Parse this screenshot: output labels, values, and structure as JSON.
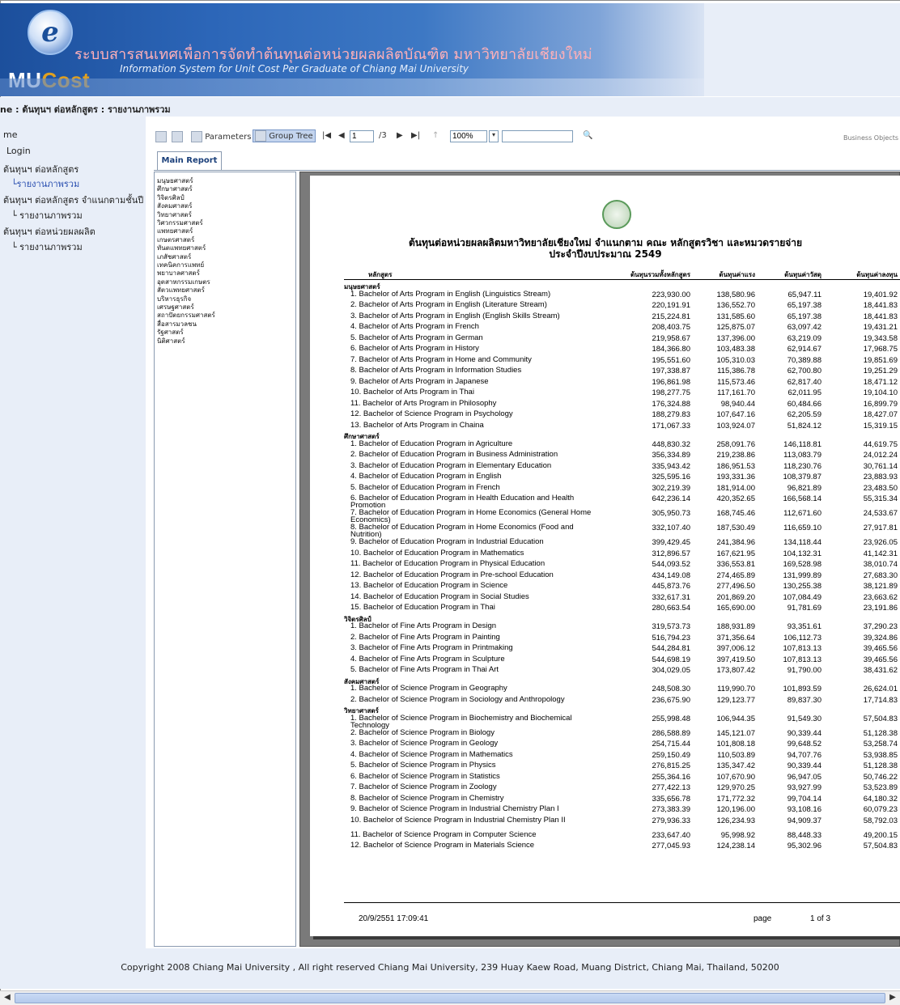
{
  "header": {
    "logo_letter": "e",
    "title_th": "ระบบสารสนเทศเพื่อการจัดทำต้นทุนต่อหน่วยผลผลิตบัณฑิต มหาวิทยาลัยเชียงใหม่",
    "title_en": "Information System for Unit Cost Per Graduate of Chiang Mai University",
    "brand_mu": "MU",
    "brand_cost": "Cost"
  },
  "breadcrumb": "ne : ต้นทุนฯ ต่อหลักสูตร : รายงานภาพรวม",
  "sidebar": {
    "items": [
      {
        "label": "me",
        "type": "link"
      },
      {
        "label": "Login",
        "type": "link"
      },
      {
        "label": "ต้นทุนฯ ต่อหลักสูตร",
        "type": "section"
      },
      {
        "label": "รายงานภาพรวม",
        "type": "current"
      },
      {
        "label": "ต้นทุนฯ ต่อหลักสูตร จำแนกตามชั้นปี",
        "type": "section"
      },
      {
        "label": "รายงานภาพรวม",
        "type": "sub"
      },
      {
        "label": "ต้นทุนฯ ต่อหน่วยผลผลิต",
        "type": "section"
      },
      {
        "label": "รายงานภาพรวม",
        "type": "sub"
      }
    ]
  },
  "toolbar": {
    "parameters_label": "Parameters",
    "group_tree_label": "Group Tree",
    "page_value": "1",
    "page_total": "/3",
    "zoom_value": "100%",
    "search_value": "",
    "brand": "Business Objects"
  },
  "tabs": {
    "main_report": "Main Report"
  },
  "group_tree": [
    "มนุษยศาสตร์",
    "ศึกษาศาสตร์",
    "วิจิตรศิลป์",
    "สังคมศาสตร์",
    "วิทยาศาสตร์",
    "วิศวกรรมศาสตร์",
    "แพทยศาสตร์",
    "เกษตรศาสตร์",
    "ทันตแพทยศาสตร์",
    "เภสัชศาสตร์",
    "เทคนิคการแพทย์",
    "พยาบาลศาสตร์",
    "อุตสาหกรรมเกษตร",
    "สัตวแพทยศาสตร์",
    "บริหารธุรกิจ",
    "เศรษฐศาสตร์",
    "สถาปัตยกรรมศาสตร์",
    "สื่อสารมวลชน",
    "รัฐศาสตร์",
    "นิติศาสตร์"
  ],
  "report": {
    "title_line1": "ต้นทุนต่อหน่วยผลผลิตมหาวิทยาลัยเชียงใหม่ จำแนกตาม คณะ หลักสูตรวิชา และหมวดรายจ่าย",
    "title_line2": "ประจำปีงบประมาณ 2549",
    "columns": [
      "หลักสูตร",
      "ต้นทุนรวมทั้งหลักสูตร",
      "ต้นทุนค่าแรง",
      "ต้นทุนค่าวัสดุ",
      "ต้นทุนค่าลงทุน"
    ],
    "groups": [
      {
        "name": "มนุษยศาสตร์",
        "rows": [
          [
            "1. Bachelor of Arts Program in English (Linguistics Stream)",
            "223,930.00",
            "138,580.96",
            "65,947.11",
            "19,401.92"
          ],
          [
            "2. Bachelor of Arts Program in English (Literature Stream)",
            "220,191.91",
            "136,552.70",
            "65,197.38",
            "18,441.83"
          ],
          [
            "3. Bachelor of Arts Program in English (English Skills Stream)",
            "215,224.81",
            "131,585.60",
            "65,197.38",
            "18,441.83"
          ],
          [
            "4. Bachelor of Arts Program in French",
            "208,403.75",
            "125,875.07",
            "63,097.42",
            "19,431.21"
          ],
          [
            "5. Bachelor of Arts Program in German",
            "219,958.67",
            "137,396.00",
            "63,219.09",
            "19,343.58"
          ],
          [
            "6. Bachelor of Arts Program in History",
            "184,366.80",
            "103,483.38",
            "62,914.67",
            "17,968.75"
          ],
          [
            "7. Bachelor of Arts Program in Home and Community",
            "195,551.60",
            "105,310.03",
            "70,389.88",
            "19,851.69"
          ],
          [
            "8. Bachelor of Arts Program in Information Studies",
            "197,338.87",
            "115,386.78",
            "62,700.80",
            "19,251.29"
          ],
          [
            "9. Bachelor of Arts Program in Japanese",
            "196,861.98",
            "115,573.46",
            "62,817.40",
            "18,471.12"
          ],
          [
            "10. Bachelor of Arts Program in Thai",
            "198,277.75",
            "117,161.70",
            "62,011.95",
            "19,104.10"
          ],
          [
            "11. Bachelor of Arts Program in Philosophy",
            "176,324.88",
            "98,940.44",
            "60,484.66",
            "16,899.79"
          ],
          [
            "12. Bachelor of Science Program in Psychology",
            "188,279.83",
            "107,647.16",
            "62,205.59",
            "18,427.07"
          ],
          [
            "13. Bachelor of Arts Program in Chaina",
            "171,067.33",
            "103,924.07",
            "51,824.12",
            "15,319.15"
          ]
        ]
      },
      {
        "name": "ศึกษาศาสตร์",
        "rows": [
          [
            "1. Bachelor of Education Program in Agriculture",
            "448,830.32",
            "258,091.76",
            "146,118.81",
            "44,619.75"
          ],
          [
            "2. Bachelor of Education Program in Business Administration",
            "356,334.89",
            "219,238.86",
            "113,083.79",
            "24,012.24"
          ],
          [
            "3. Bachelor of Education Program in Elementary Education",
            "335,943.42",
            "186,951.53",
            "118,230.76",
            "30,761.14"
          ],
          [
            "4. Bachelor of Education Program in English",
            "325,595.16",
            "193,331.36",
            "108,379.87",
            "23,883.93"
          ],
          [
            "5. Bachelor of Education Program in French",
            "302,219.39",
            "181,914.00",
            "96,821.89",
            "23,483.50"
          ],
          [
            "6. Bachelor of Education Program in Health Education and Health Promotion",
            "642,236.14",
            "420,352.65",
            "166,568.14",
            "55,315.34"
          ],
          [
            "7. Bachelor of Education Program in Home Economics (General Home Economics)",
            "305,950.73",
            "168,745.46",
            "112,671.60",
            "24,533.67"
          ],
          [
            "8. Bachelor of Education Program in Home Economics (Food and Nutrition)",
            "332,107.40",
            "187,530.49",
            "116,659.10",
            "27,917.81"
          ],
          [
            "9. Bachelor of Education Program in Industrial Education",
            "399,429.45",
            "241,384.96",
            "134,118.44",
            "23,926.05"
          ],
          [
            "10. Bachelor of Education Program in Mathematics",
            "312,896.57",
            "167,621.95",
            "104,132.31",
            "41,142.31"
          ],
          [
            "11. Bachelor of Education Program in Physical Education",
            "544,093.52",
            "336,553.81",
            "169,528.98",
            "38,010.74"
          ],
          [
            "12. Bachelor of Education Program in Pre-school Education",
            "434,149.08",
            "274,465.89",
            "131,999.89",
            "27,683.30"
          ],
          [
            "13. Bachelor of Education Program in Science",
            "445,873.76",
            "277,496.50",
            "130,255.38",
            "38,121.89"
          ],
          [
            "14. Bachelor of Education Program in Social Studies",
            "332,617.31",
            "201,869.20",
            "107,084.49",
            "23,663.62"
          ],
          [
            "15. Bachelor of Education Program in Thai",
            "280,663.54",
            "165,690.00",
            "91,781.69",
            "23,191.86"
          ]
        ]
      },
      {
        "name": "วิจิตรศิลป์",
        "rows": [
          [
            "1. Bachelor of Fine Arts Program in Design",
            "319,573.73",
            "188,931.89",
            "93,351.61",
            "37,290.23"
          ],
          [
            "2. Bachelor of Fine Arts Program in Painting",
            "516,794.23",
            "371,356.64",
            "106,112.73",
            "39,324.86"
          ],
          [
            "3. Bachelor of Fine Arts Program in Printmaking",
            "544,284.81",
            "397,006.12",
            "107,813.13",
            "39,465.56"
          ],
          [
            "4. Bachelor of Fine Arts Program in Sculpture",
            "544,698.19",
            "397,419.50",
            "107,813.13",
            "39,465.56"
          ],
          [
            "5. Bachelor of Fine Arts Program in Thai Art",
            "304,029.05",
            "173,807.42",
            "91,790.00",
            "38,431.62"
          ]
        ]
      },
      {
        "name": "สังคมศาสตร์",
        "rows": [
          [
            "1. Bachelor of Science Program in Geography",
            "248,508.30",
            "119,990.70",
            "101,893.59",
            "26,624.01"
          ],
          [
            "2. Bachelor of Science Program in Sociology and Anthropology",
            "236,675.90",
            "129,123.77",
            "89,837.30",
            "17,714.83"
          ]
        ]
      },
      {
        "name": "วิทยาศาสตร์",
        "rows": [
          [
            "1. Bachelor of Science Program in Biochemistry and Biochemical Technology",
            "255,998.48",
            "106,944.35",
            "91,549.30",
            "57,504.83"
          ],
          [
            "2. Bachelor of Science Program in Biology",
            "286,588.89",
            "145,121.07",
            "90,339.44",
            "51,128.38"
          ],
          [
            "3. Bachelor of Science Program in Geology",
            "254,715.44",
            "101,808.18",
            "99,648.52",
            "53,258.74"
          ],
          [
            "4. Bachelor of Science Program in Mathematics",
            "259,150.49",
            "110,503.89",
            "94,707.76",
            "53,938.85"
          ],
          [
            "5. Bachelor of Science Program in Physics",
            "276,815.25",
            "135,347.42",
            "90,339.44",
            "51,128.38"
          ],
          [
            "6. Bachelor of Science Program in Statistics",
            "255,364.16",
            "107,670.90",
            "96,947.05",
            "50,746.22"
          ],
          [
            "7. Bachelor of Science Program in Zoology",
            "277,422.13",
            "129,970.25",
            "93,927.99",
            "53,523.89"
          ],
          [
            "8. Bachelor of Science Program in Chemistry",
            "335,656.78",
            "171,772.32",
            "99,704.14",
            "64,180.32"
          ],
          [
            "9. Bachelor of Science Program in Industrial Chemistry Plan I",
            "273,383.39",
            "120,196.00",
            "93,108.16",
            "60,079.23"
          ],
          [
            "10. Bachelor of Science Program in Industrial Chemistry Plan II",
            "279,936.33",
            "126,234.93",
            "94,909.37",
            "58,792.03"
          ],
          [
            "11. Bachelor of Science Program in Computer Science",
            "233,647.40",
            "95,998.92",
            "88,448.33",
            "49,200.15"
          ],
          [
            "12. Bachelor of Science Program in Materials Science",
            "277,045.93",
            "124,238.14",
            "95,302.96",
            "57,504.83"
          ]
        ]
      }
    ],
    "footer_date": "20/9/2551 17:09:41",
    "footer_page_label": "page",
    "footer_page_value": "1 of 3"
  },
  "copyright": "Copyright 2008 Chiang Mai University , All right reserved Chiang Mai University, 239 Huay Kaew Road, Muang District, Chiang Mai, Thailand, 50200"
}
